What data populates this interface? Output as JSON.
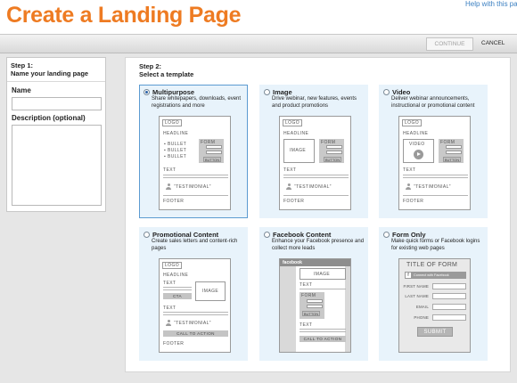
{
  "header": {
    "title": "Create a Landing Page",
    "help_link": "Help with this page"
  },
  "actions": {
    "continue": "CONTINUE",
    "cancel": "CANCEL"
  },
  "step1": {
    "heading": "Step 1:",
    "subheading": "Name your landing page",
    "name_label": "Name",
    "name_value": "",
    "description_label": "Description (optional)",
    "description_value": ""
  },
  "step2": {
    "heading": "Step 2:",
    "subheading": "Select a template"
  },
  "templates": [
    {
      "title": "Multipurpose",
      "description": "Share whitepapers, downloads, event registrations and more",
      "selected": true,
      "thumb": {
        "logo": "LOGO",
        "headline": "HEADLINE",
        "bullets": [
          "BULLET",
          "BULLET",
          "BULLET"
        ],
        "form": "FORM",
        "button": "BUTTON",
        "text": "TEXT",
        "testimonial": "“TESTIMONIAL”",
        "footer": "FOOTER"
      }
    },
    {
      "title": "Image",
      "description": "Drive webinar, new features, events and product promotions",
      "selected": false,
      "thumb": {
        "logo": "LOGO",
        "headline": "HEADLINE",
        "image": "IMAGE",
        "form": "FORM",
        "button": "BUTTON",
        "text": "TEXT",
        "testimonial": "“TESTIMONIAL”",
        "footer": "FOOTER"
      }
    },
    {
      "title": "Video",
      "description": "Deliver webinar announcements, instructional or promotional content",
      "selected": false,
      "thumb": {
        "logo": "LOGO",
        "headline": "HEADLINE",
        "video": "VIDEO",
        "form": "FORM",
        "button": "BUTTON",
        "text": "TEXT",
        "testimonial": "“TESTIMONIAL”",
        "footer": "FOOTER"
      }
    },
    {
      "title": "Promotional Content",
      "description": "Create sales letters and content-rich pages",
      "selected": false,
      "thumb": {
        "logo": "LOGO",
        "headline": "HEADLINE",
        "text": "TEXT",
        "cta": "CTA",
        "image": "IMAGE",
        "text2": "TEXT",
        "testimonial": "“TESTIMONIAL”",
        "call_to_action": "CALL TO ACTION",
        "footer": "FOOTER"
      }
    },
    {
      "title": "Facebook Content",
      "description": "Enhance your Facebook presence and collect more leads",
      "selected": false,
      "thumb": {
        "bar": "facebook",
        "image": "IMAGE",
        "text": "TEXT",
        "form": "FORM",
        "button": "BUTTON",
        "text2": "TEXT",
        "call_to_action": "CALL TO ACTION"
      }
    },
    {
      "title": "Form Only",
      "description": "Make quick forms or Facebook logins for existing web pages",
      "selected": false,
      "thumb": {
        "title": "TITLE OF FORM",
        "connect": "Connect with Facebook",
        "fields": [
          "FIRST NAME",
          "LAST NAME",
          "EMAIL",
          "PHONE"
        ],
        "submit": "SUBMIT"
      }
    }
  ],
  "colors": {
    "title_orange": "#ee7b22",
    "link_blue": "#3a7fc1",
    "card_bg": "#e8f3fb",
    "selected_border": "#5c9bd1"
  }
}
